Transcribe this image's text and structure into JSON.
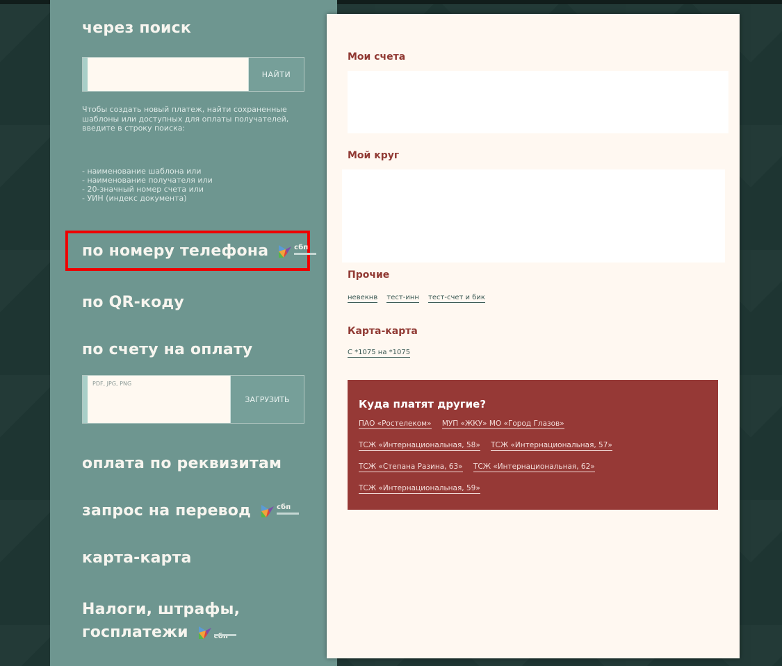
{
  "left": {
    "search_title": "через поиск",
    "search_value": "",
    "search_button": "НАЙТИ",
    "help_text": "Чтобы создать новый платеж, найти сохраненные шаблоны или доступных для оплаты получателей, введите в строку поиска:",
    "help_items": [
      "- наименование шаблона или",
      "- наименование получателя или",
      "- 20-значный номер счета или",
      "- УИН (индекс документа)"
    ],
    "by_phone": "по номеру телефона",
    "by_qr": "по QR-коду",
    "by_invoice": "по счету на оплату",
    "upload_hint": "PDF, JPG, PNG",
    "upload_button": "ЗАГРУЗИТЬ",
    "by_requisites": "оплата по реквизитам",
    "transfer_request": "запрос на перевод",
    "card_to_card": "карта-карта",
    "taxes_line1": "Налоги, штрафы,",
    "taxes_line2": "госплатежи",
    "sbp_label": "сбп"
  },
  "right": {
    "my_accounts": "Мои счета",
    "my_circle": "Мой круг",
    "other_title": "Прочие",
    "other_links": [
      "невекнв",
      "тест-инн",
      "тест-счет и бик"
    ],
    "card_title": "Карта-карта",
    "card_links": [
      "С *1075 на *1075"
    ],
    "others_title": "Куда платят другие?",
    "others_links": [
      "ПАО «Ростелеком»",
      "МУП «ЖКУ» МО «Город Глазов»",
      "ТСЖ «Интернациональная, 58»",
      "ТСЖ «Интернациональная, 57»",
      "ТСЖ «Степана Разина, 63»",
      "ТСЖ «Интернациональная, 62»",
      "ТСЖ «Интернациональная, 59»"
    ]
  },
  "colors": {
    "left_panel": "#6e9690",
    "accent_red": "#963936",
    "title_red": "#913a34",
    "highlight": "#ee0000"
  }
}
